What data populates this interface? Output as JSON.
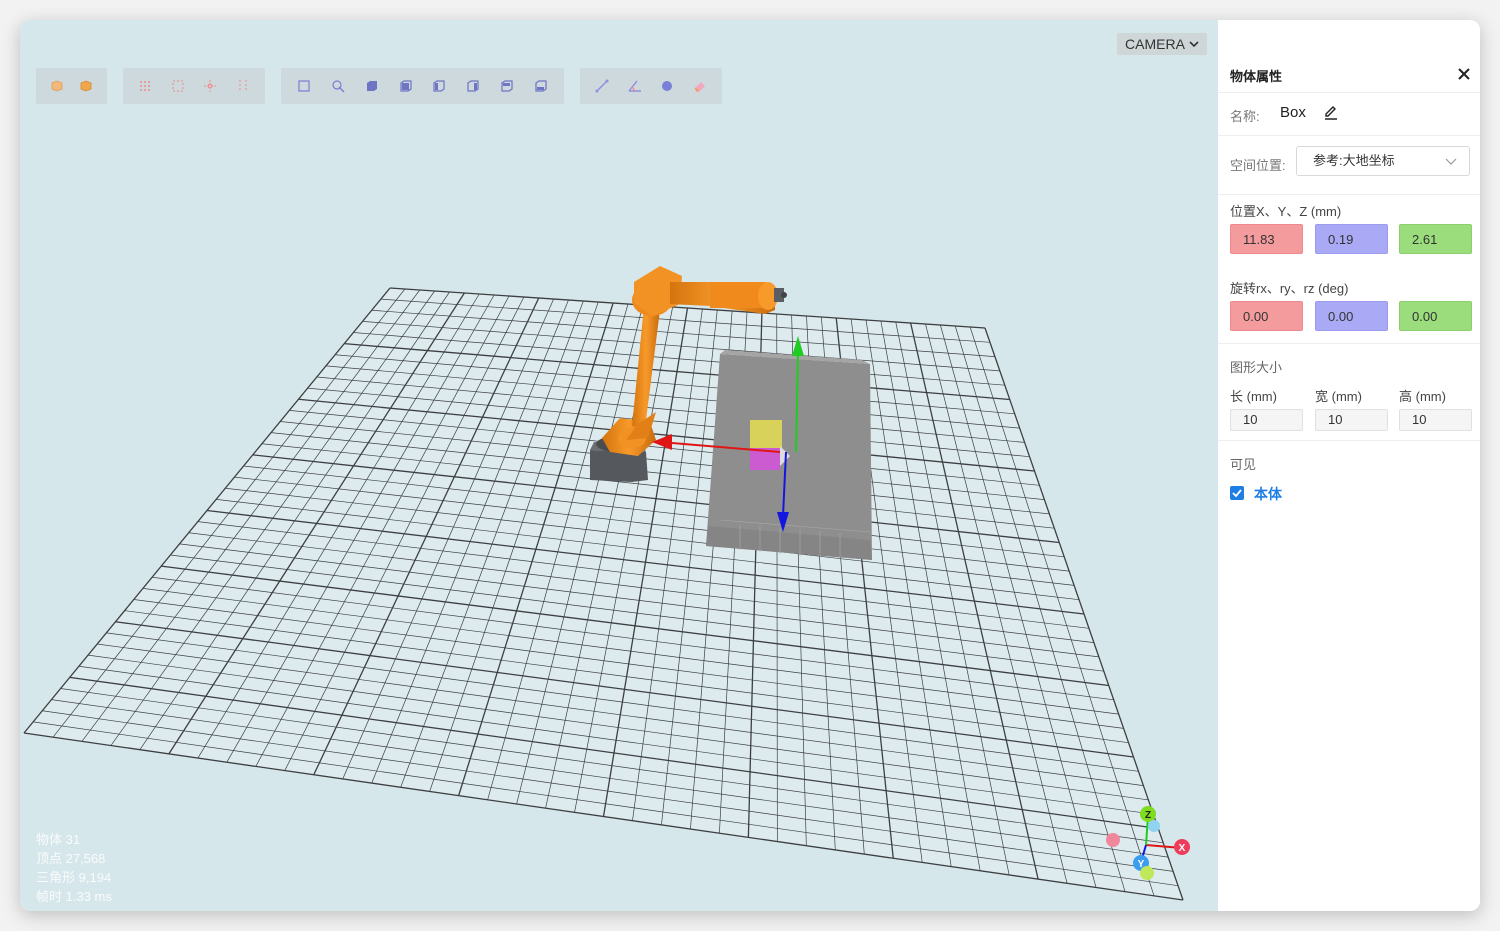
{
  "viewport": {
    "camera_label": "CAMERA",
    "background": "#d6e7eb",
    "stats": [
      {
        "label": "物体",
        "value": "31"
      },
      {
        "label": "顶点",
        "value": "27,568"
      },
      {
        "label": "三角形",
        "value": "9,194"
      },
      {
        "label": "帧时",
        "value": "1.33 ms"
      }
    ],
    "axis_labels": {
      "x": "X",
      "y": "Y",
      "z": "Z"
    },
    "colors": {
      "robot": "#f08a1c",
      "box": "#8e8e8e",
      "x_axis": "#e01515",
      "y_axis": "#1fcc1f",
      "z_axis": "#1515e0"
    },
    "toolbar": [
      {
        "group": "view",
        "icons": [
          "cube-solid-icon",
          "cube-shaded-icon"
        ]
      },
      {
        "group": "snap",
        "icons": [
          "grid-dots-icon",
          "grid-corners-icon",
          "grid-move-icon",
          "grid-vertical-icon"
        ]
      },
      {
        "group": "views",
        "icons": [
          "frame-icon",
          "select-icon",
          "view-front-icon",
          "view-back-icon",
          "view-left-icon",
          "view-right-icon",
          "view-top-icon",
          "view-bottom-icon"
        ]
      },
      {
        "group": "measure",
        "icons": [
          "measure-line-icon",
          "measure-angle-icon",
          "point-icon",
          "eraser-icon"
        ]
      }
    ]
  },
  "panel": {
    "title": "物体属性",
    "name_label": "名称:",
    "name_value": "Box",
    "space_label": "空间位置:",
    "space_value": "参考:大地坐标",
    "position_label": "位置X、Y、Z (mm)",
    "position": {
      "x": "11.83",
      "y": "0.19",
      "z": "2.61"
    },
    "rotation_label": "旋转rx、ry、rz (deg)",
    "rotation": {
      "rx": "0.00",
      "ry": "0.00",
      "rz": "0.00"
    },
    "size_label": "图形大小",
    "size": [
      {
        "label": "长 (mm)",
        "value": "10"
      },
      {
        "label": "宽 (mm)",
        "value": "10"
      },
      {
        "label": "高 (mm)",
        "value": "10"
      }
    ],
    "visible_label": "可见",
    "visible_checkbox_label": "本体",
    "visible_checked": true,
    "accent": "#1f7ee6"
  }
}
